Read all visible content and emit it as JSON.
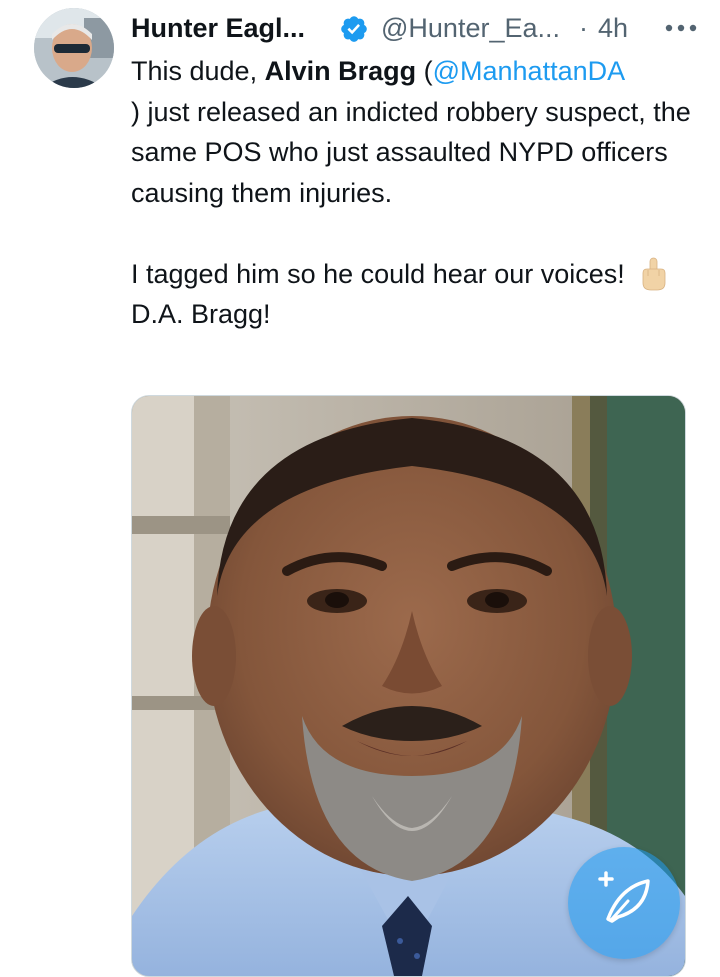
{
  "tweet": {
    "author_name": "Hunter Eagl...",
    "handle": "@Hunter_Ea...",
    "separator": "·",
    "time": "4h",
    "text_part1": "This dude, ",
    "mention_name": "Alvin Bragg",
    "paren_open": " (",
    "mention_handle": "@ManhattanDA",
    "text_part2": ") just released an indicted robbery suspect, the same POS who just assaulted NYPD officers causing them injuries.",
    "text_part3": "I tagged him so he could hear our voices!",
    "emoji": "middle-finger",
    "text_part4": "D.A. Bragg!"
  },
  "icons": {
    "verified": "verified-badge-icon",
    "more": "more-options-icon",
    "compose": "compose-post-icon"
  },
  "colors": {
    "link": "#1d9bf0",
    "secondary_text": "#536471",
    "primary_text": "#0f1419",
    "fab": "#1d9bf0"
  }
}
